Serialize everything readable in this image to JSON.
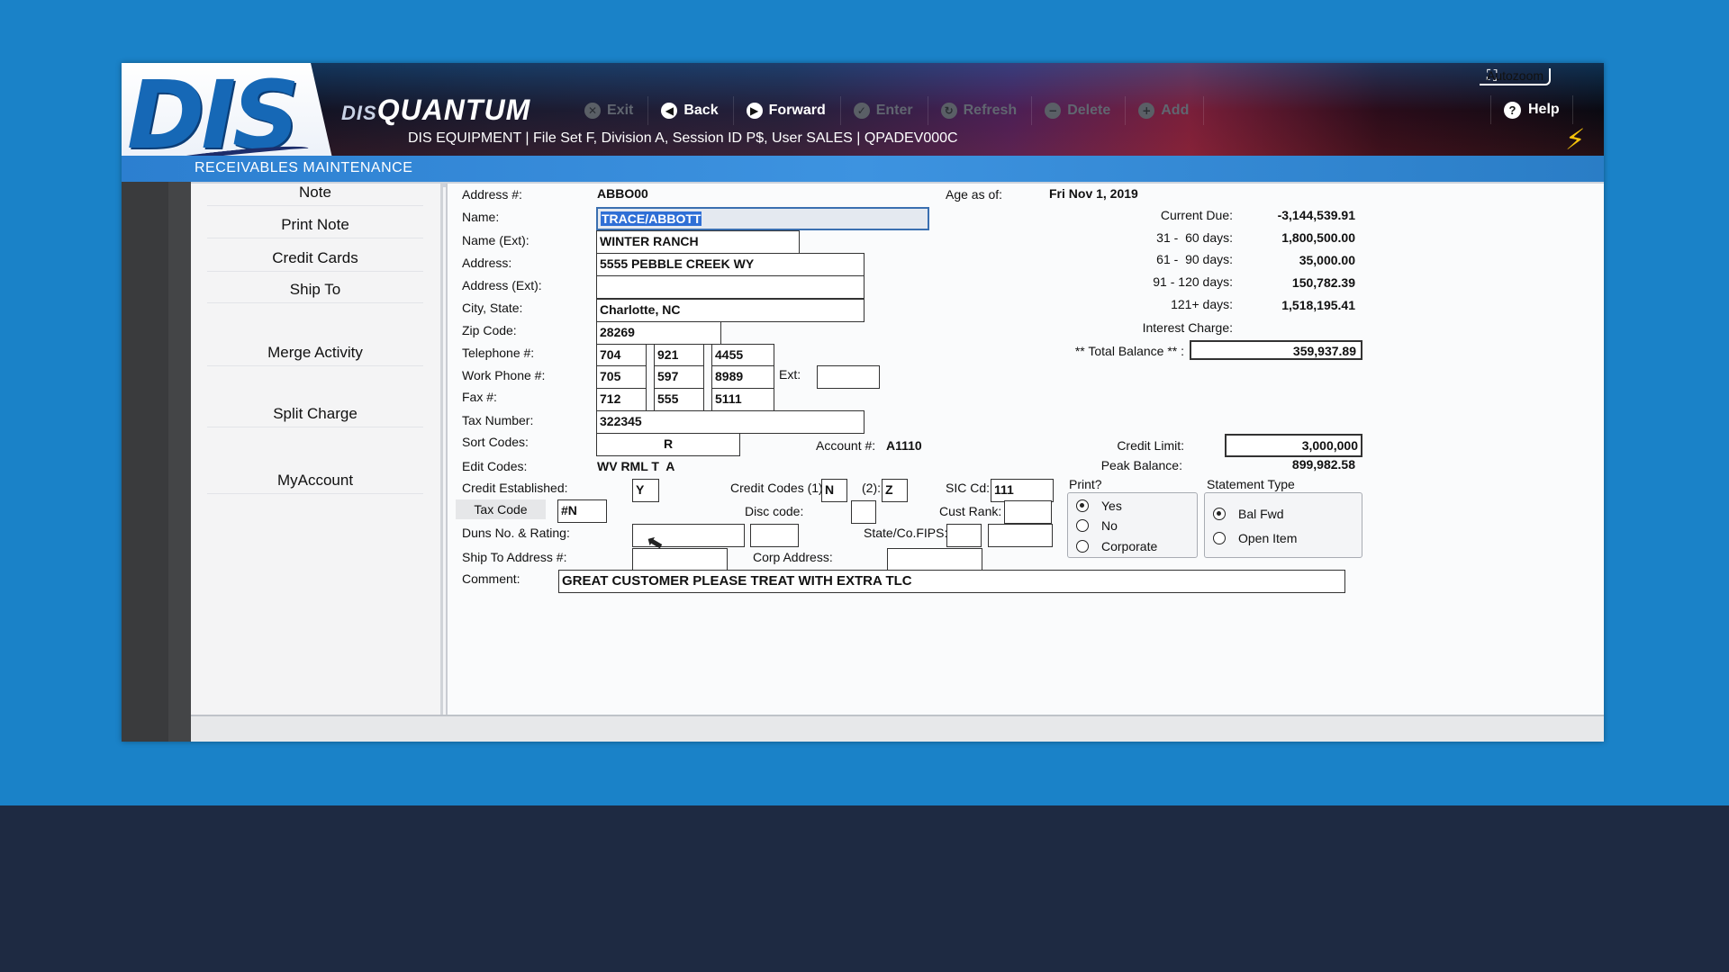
{
  "header": {
    "logo_text": "DIS",
    "brand_small": "DIS",
    "brand_big": "QUANTUM",
    "session": "DIS EQUIPMENT | File Set F, Division A, Session ID P$, User SALES | QPADEV000C",
    "autozoom": "Autozoom",
    "toolbar": [
      {
        "label": "Exit",
        "enabled": false,
        "icon": "close-circle-icon"
      },
      {
        "label": "Back",
        "enabled": true,
        "icon": "arrow-left-circle-icon"
      },
      {
        "label": "Forward",
        "enabled": true,
        "icon": "arrow-right-circle-icon"
      },
      {
        "label": "Enter",
        "enabled": false,
        "icon": "check-circle-icon"
      },
      {
        "label": "Refresh",
        "enabled": false,
        "icon": "refresh-icon"
      },
      {
        "label": "Delete",
        "enabled": false,
        "icon": "minus-circle-icon"
      },
      {
        "label": "Add",
        "enabled": false,
        "icon": "plus-circle-icon"
      }
    ],
    "help": "Help",
    "screen_title": "RECEIVABLES MAINTENANCE"
  },
  "nav": [
    "Note",
    "Print Note",
    "Credit Cards",
    "Ship To",
    "Merge Activity",
    "Split Charge",
    "MyAccount"
  ],
  "form": {
    "address_no_label": "Address #:",
    "address_no": "ABBO00",
    "age_label": "Age as of:",
    "age": "Fri Nov 1, 2019",
    "name_label": "Name:",
    "name": "TRACE/ABBOTT",
    "name_ext_label": "Name (Ext):",
    "name_ext": "WINTER RANCH",
    "address_label": "Address:",
    "address": "5555 PEBBLE CREEK WY",
    "address_ext_label": "Address (Ext):",
    "address_ext": "",
    "city_label": "City, State:",
    "city": "Charlotte, NC",
    "zip_label": "Zip Code:",
    "zip": "28269",
    "tel_label": "Telephone #:",
    "tel": [
      "704",
      "921",
      "4455"
    ],
    "work_label": "Work Phone #:",
    "work": [
      "705",
      "597",
      "8989"
    ],
    "ext_label": "Ext:",
    "ext": "",
    "fax_label": "Fax #:",
    "fax": [
      "712",
      "555",
      "5111"
    ],
    "tax_no_label": "Tax Number:",
    "tax_no": "322345",
    "sort_label": "Sort Codes:",
    "sort": "R",
    "account_label": "Account #:",
    "account": "A1110",
    "edit_label": "Edit Codes:",
    "edit": "WV RML T  A",
    "credit_est_label": "Credit Established:",
    "credit_est": "Y",
    "credit_codes_label": "Credit Codes (1):",
    "credit_code1": "N",
    "credit_code2_label": "(2):",
    "credit_code2": "Z",
    "sic_label": "SIC Cd:",
    "sic": "111",
    "tax_code_btn": "Tax Code",
    "tax_code": "#N",
    "disc_label": "Disc code:",
    "disc": "",
    "cust_rank_label": "Cust Rank:",
    "cust_rank": "",
    "duns_label": "Duns No. & Rating:",
    "state_fips_label": "State/Co.FIPS:",
    "ship_to_label": "Ship To Address #:",
    "corp_label": "Corp Address:",
    "comment_label": "Comment:",
    "comment": "GREAT CUSTOMER PLEASE TREAT WITH EXTRA TLC"
  },
  "aging": {
    "rows": [
      {
        "label": "Current Due:",
        "value": "-3,144,539.91"
      },
      {
        "label": "31 -  60 days:",
        "value": "1,800,500.00"
      },
      {
        "label": "61 -  90 days:",
        "value": "35,000.00"
      },
      {
        "label": "91 - 120 days:",
        "value": "150,782.39"
      },
      {
        "label": "121+ days:",
        "value": "1,518,195.41"
      },
      {
        "label": "Interest Charge:",
        "value": ""
      }
    ],
    "total_label": "** Total Balance ** :",
    "total": "359,937.89",
    "credit_limit_label": "Credit Limit:",
    "credit_limit": "3,000,000",
    "peak_label": "Peak Balance:",
    "peak": "899,982.58"
  },
  "print": {
    "title": "Print?",
    "options": [
      "Yes",
      "No",
      "Corporate"
    ],
    "selected": "Yes"
  },
  "statement": {
    "title": "Statement Type",
    "options": [
      "Bal Fwd",
      "Open Item"
    ],
    "selected": "Bal Fwd"
  }
}
